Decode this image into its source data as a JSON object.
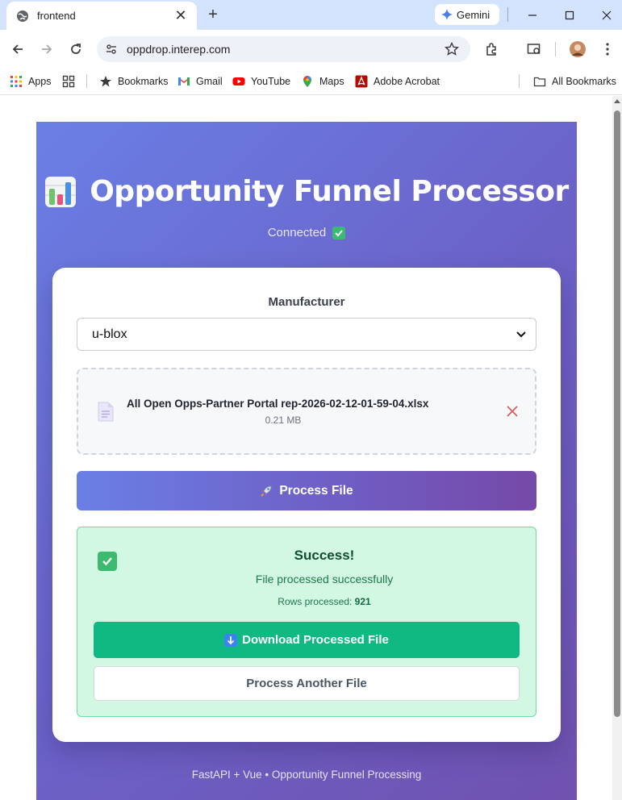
{
  "browser": {
    "tab_title": "frontend",
    "new_tab_symbol": "+",
    "close_tab_symbol": "✕",
    "gemini_label": "Gemini",
    "url": "oppdrop.interep.com"
  },
  "bookmarks": {
    "apps": "Apps",
    "bookmarks": "Bookmarks",
    "gmail": "Gmail",
    "youtube": "YouTube",
    "maps": "Maps",
    "acrobat": "Adobe Acrobat",
    "all_bookmarks": "All Bookmarks"
  },
  "app": {
    "title": "Opportunity Funnel Processor",
    "connection_status": "Connected",
    "manufacturer_label": "Manufacturer",
    "manufacturer_value": "u-blox",
    "file_name": "All Open Opps-Partner Portal rep-2026-02-12-01-59-04.xlsx",
    "file_size": "0.21 MB",
    "process_button": "Process File",
    "success_title": "Success!",
    "success_message": "File processed successfully",
    "rows_label": "Rows processed:",
    "rows_value": "921",
    "download_button": "Download Processed File",
    "another_button": "Process Another File",
    "footer": "FastAPI + Vue • Opportunity Funnel Processing"
  },
  "icons": {
    "title_icon": "bar-chart-icon",
    "connected_icon": "check-mark-button-icon",
    "process_icon": "rocket-icon",
    "download_icon": "down-arrow-icon",
    "remove_icon": "close-icon",
    "file_icon": "document-icon"
  },
  "colors": {
    "gradient_start": "#6a7fe5",
    "gradient_end": "#7051ae",
    "success_bg": "#d2f7e3",
    "success_border": "#6fdb9f",
    "download_green": "#10b981",
    "remove_red": "#e05252"
  }
}
